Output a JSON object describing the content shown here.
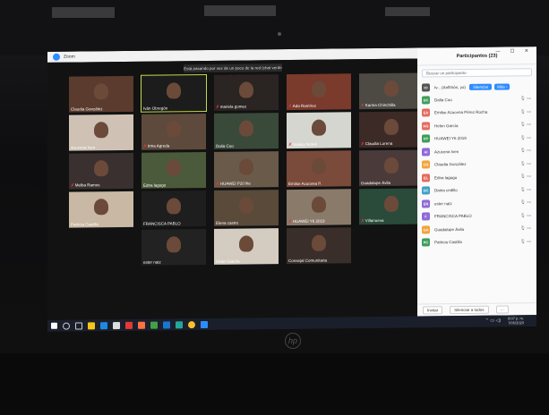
{
  "window": {
    "app_title": "Zoom",
    "share_banner": "Está pasando por vez de un poco de la red (chat verde a Aura)"
  },
  "gallery": {
    "tiles": [
      {
        "name": "Claudia González",
        "muted": false,
        "color": "#5a3b2e"
      },
      {
        "name": "Iván Obregón",
        "muted": false,
        "color": "#1c1c1c",
        "active": true
      },
      {
        "name": "mariela gomez",
        "muted": true,
        "color": "#2a2422"
      },
      {
        "name": "Ada Ramírez",
        "muted": true,
        "color": "#7a3a2c"
      },
      {
        "name": "Karina Chinchilla",
        "muted": true,
        "color": "#4d4a44"
      },
      {
        "name": "Azucena Iven",
        "muted": false,
        "color": "#cfc2b4"
      },
      {
        "name": "Irma Agreda",
        "muted": true,
        "color": "#5d4a3c"
      },
      {
        "name": "Dalia Coo",
        "muted": false,
        "color": "#3a4a3a"
      },
      {
        "name": "Galaxy Note8",
        "muted": true,
        "color": "#d6d6d0"
      },
      {
        "name": "Claudia Lorena",
        "muted": true,
        "color": "#3c2a26"
      },
      {
        "name": "Melba Ramos",
        "muted": true,
        "color": "#3a3030"
      },
      {
        "name": "Edna lagugo",
        "muted": false,
        "color": "#4a5a3a"
      },
      {
        "name": "HUAWEI P20 lite",
        "muted": true,
        "color": "#6a5a4a"
      },
      {
        "name": "Emilse Azucena P.",
        "muted": false,
        "color": "#7a4a3a"
      },
      {
        "name": "Guadalupe Ávila",
        "muted": false,
        "color": "#4a3a3a"
      },
      {
        "name": "Patricia Castillo",
        "muted": false,
        "color": "#c8b8a4"
      },
      {
        "name": "FRANCISCA PABLO",
        "muted": false,
        "color": "#1e1e1e"
      },
      {
        "name": "Elena castro",
        "muted": false,
        "color": "#5a4a3a"
      },
      {
        "name": "HUAWEI Y6 2019",
        "muted": true,
        "color": "#8a7a6a"
      },
      {
        "name": "Villanueva",
        "muted": true,
        "color": "#2a4a3a"
      },
      {
        "name": "ester natz",
        "muted": false,
        "color": "#222222"
      },
      {
        "name": "Helen García",
        "muted": false,
        "color": "#d4ccc0"
      },
      {
        "name": "Consejal Comunitaria",
        "muted": false,
        "color": "#3a2e2a"
      }
    ]
  },
  "panel": {
    "title": "Participantes (23)",
    "window_controls": "— ☐ ✕",
    "search_placeholder": "Buscar un participante",
    "me": {
      "name": "Iv... (Anfitrión, yo)",
      "mute_all_label": "Silenciar",
      "more_label": "Más ›"
    },
    "participants": [
      {
        "initials": "DC",
        "name": "Dalia Coo",
        "color": "#3f9c5a"
      },
      {
        "initials": "EA",
        "name": "Emilse Azucena Pérez Rocha",
        "color": "#e56b5d"
      },
      {
        "initials": "HG",
        "name": "Helen García",
        "color": "#e56b5d"
      },
      {
        "initials": "HY",
        "name": "HUAWEI Y6 2019",
        "color": "#3f9c5a"
      },
      {
        "initials": "AI",
        "name": "Azucena Iven",
        "color": "#8e6bd6"
      },
      {
        "initials": "CG",
        "name": "Claudia González",
        "color": "#f2a33a"
      },
      {
        "initials": "EL",
        "name": "Edna lagugo",
        "color": "#e56b5d"
      },
      {
        "initials": "DC",
        "name": "Dania cedillo",
        "color": "#3fa0c4"
      },
      {
        "initials": "EN",
        "name": "ester natz",
        "color": "#8e6bd6"
      },
      {
        "initials": "F",
        "name": "FRANCISCA PABLO",
        "color": "#8e6bd6"
      },
      {
        "initials": "GA",
        "name": "Guadalupe Ávila",
        "color": "#f2a33a"
      },
      {
        "initials": "PC",
        "name": "Patricia Castillo",
        "color": "#3f9c5a"
      }
    ],
    "footer": {
      "invite": "Invitar",
      "mute_all": "Silenciar a todos",
      "more": "···"
    }
  },
  "taskbar": {
    "clock_time": "8:07 p. m.",
    "clock_date": "7/05/2020"
  }
}
